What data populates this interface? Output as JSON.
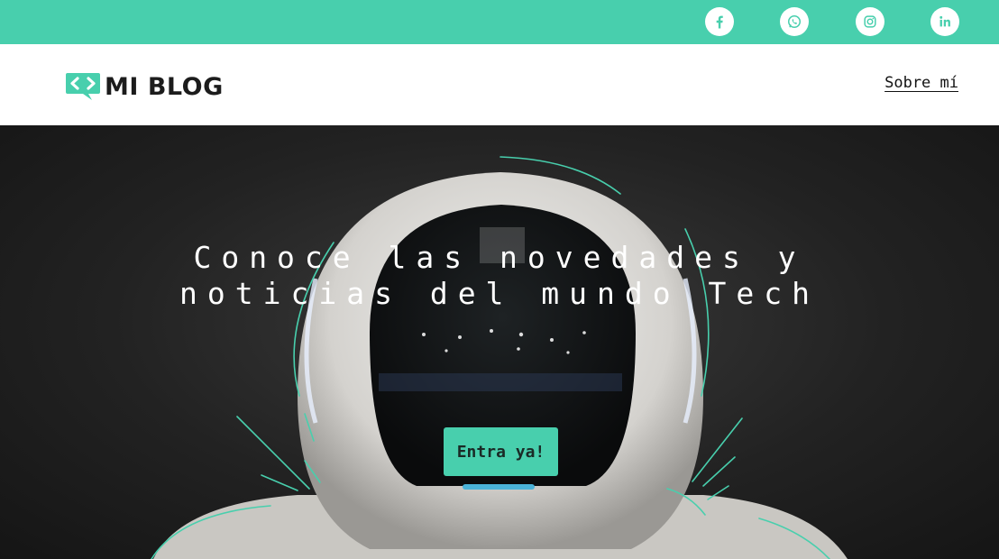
{
  "social": [
    {
      "name": "facebook-icon"
    },
    {
      "name": "whatsapp-icon"
    },
    {
      "name": "instagram-icon"
    },
    {
      "name": "linkedin-icon"
    }
  ],
  "header": {
    "logo_text": "MI BLOG",
    "nav_link": "Sobre mí"
  },
  "hero": {
    "title_line1": "Conoce las novedades y",
    "title_line2": "noticias del mundo Tech",
    "cta_label": "Entra ya!"
  },
  "colors": {
    "accent": "#48cfad",
    "dark": "#1c1c1c"
  }
}
